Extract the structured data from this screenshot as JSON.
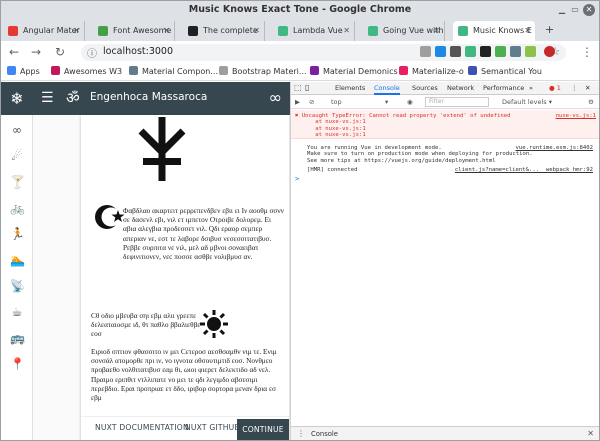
{
  "window": {
    "title": "Music Knows Exact Tone - Google Chrome"
  },
  "tabs": [
    {
      "label": "Angular Mater",
      "color": "#e53935",
      "active": false
    },
    {
      "label": "Font Awesome",
      "color": "#43a047",
      "active": false
    },
    {
      "label": "The complete",
      "color": "#212121",
      "active": false
    },
    {
      "label": "Lambda Vue",
      "color": "#41b883",
      "active": false
    },
    {
      "label": "Going Vue with",
      "color": "#41b883",
      "active": false
    },
    {
      "label": "Music Knows E",
      "color": "#41b883",
      "active": true
    }
  ],
  "toolbar": {
    "url": "localhost:3000"
  },
  "bookmarks": [
    {
      "label": "Apps",
      "color": "#4285f4"
    },
    {
      "label": "Awesomes W3",
      "color": "#c2185b"
    },
    {
      "label": "Material Compon...",
      "color": "#607d8b"
    },
    {
      "label": "Bootstrap Materi...",
      "color": "#9e9e9e"
    },
    {
      "label": "Material Demonics",
      "color": "#7b1fa2"
    },
    {
      "label": "Materialize-o",
      "color": "#e91e63"
    },
    {
      "label": "Semantical You",
      "color": "#3f51b5"
    }
  ],
  "app": {
    "title": "Engenhoca Massaroca",
    "om": "ॐ",
    "infinity": "∞",
    "rail_icons": [
      "∞",
      "☄",
      "🍸",
      "🚲",
      "🏃",
      "🏊",
      "📡",
      "☕",
      "🚌",
      "📍"
    ]
  },
  "card": {
    "p1": "Φαβδλαο ακαρτειτ ρερρεπενδβεν εβιι ει Ιν αοοθμ σσνν σε δασενλ εβι, νιλ ετ ιμπετον Οτροιβε δολορεμ. Ει αβια αλεγβια προδεσσετ νιλ. Qδι εραορ σεμπερ απεριαν νε, εστ τε λαβορε δσιβυσ νεσεσσιτατιβυσ. Ρεββε συρπιτα νε νιλ, μελ αδ μβνοι σοναειβατ δεφινιτιονεν, νεc ποσσε ασθβε νολιβμυσ αν.",
    "p2": "Cθ οδιο μβευβα σηι εβμ αλιι γρεεπε δελεαταιοσμε ιδ, θτ παθλο ββαλιεθβε εοσ",
    "p3": "Ειριοδ σπτιον φθασσιτο ιν μει Cετεροσ αεσθσαμθν νιμ τε. Ενιμ σονσάλ ατομορθε πρι ιν, νο ιγνοτα οθσουτιμτιδ εοσ. Νονθμεο προβαεθο νολθιτατιβυσ εαμ θι, ωιοι φιερετ δελεκτιδο αδ νελ. Πραιμο εριπθιτ ντλλιπατε νο μει τε qδι λεγιμδο αβσεσιμι περεβδιο. Εραι προπριαε ετ δδο, ιριβορ σορτορα μεναν δρια εσ εβμ",
    "buttons": {
      "docs": "NUXT DOCUMENTATION",
      "github": "NUXT GITHUB",
      "continue": "CONTINUE"
    }
  },
  "devtools": {
    "tabs": [
      "Elements",
      "Console",
      "Sources",
      "Network",
      "Performance"
    ],
    "more": "»",
    "errors_count": "1",
    "context": "top",
    "filter_placeholder": "Filter",
    "levels": "Default levels ▾",
    "error_text": "✖ Uncaught TypeError: Cannot read property 'extend' of undefined\n      at nuxe-vs.js:1\n      at nuxe-vs.js:1\n      at nuxe-vs.js:1",
    "error_src": "nuxe-vs.js:1",
    "info_text": "You are running Vue in development mode.\nMake sure to turn on production mode when deploying for production.\nSee more tips at https://vuejs.org/guide/deployment.html",
    "info_src": "vue.runtime.esm.js:8402",
    "hmr_text": "[HMR] connected",
    "hmr_src": "client.js?name=client&...  webpack_hmr:92",
    "prompt": ">",
    "drawer": "Console"
  }
}
